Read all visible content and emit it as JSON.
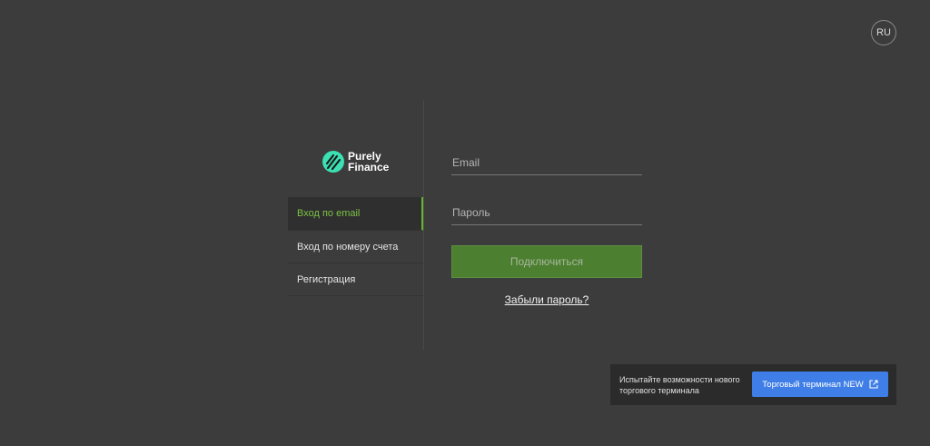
{
  "header": {
    "language": "RU"
  },
  "brand": {
    "line1": "Purely",
    "line2": "Finance",
    "accent": "#3be0b3"
  },
  "nav": {
    "items": [
      {
        "label": "Вход по email",
        "active": true
      },
      {
        "label": "Вход по номеру счета",
        "active": false
      },
      {
        "label": "Регистрация",
        "active": false
      }
    ]
  },
  "form": {
    "email_placeholder": "Email",
    "password_placeholder": "Пароль",
    "submit_label": "Подключиться",
    "forgot_label": "Забыли пароль?"
  },
  "promo": {
    "text": "Испытайте возможности нового торгового терминала",
    "button_label": "Торговый терминал NEW",
    "button_icon": "external-link-icon"
  },
  "colors": {
    "accent_green": "#67b52e",
    "promo_blue": "#3f7ee6"
  }
}
